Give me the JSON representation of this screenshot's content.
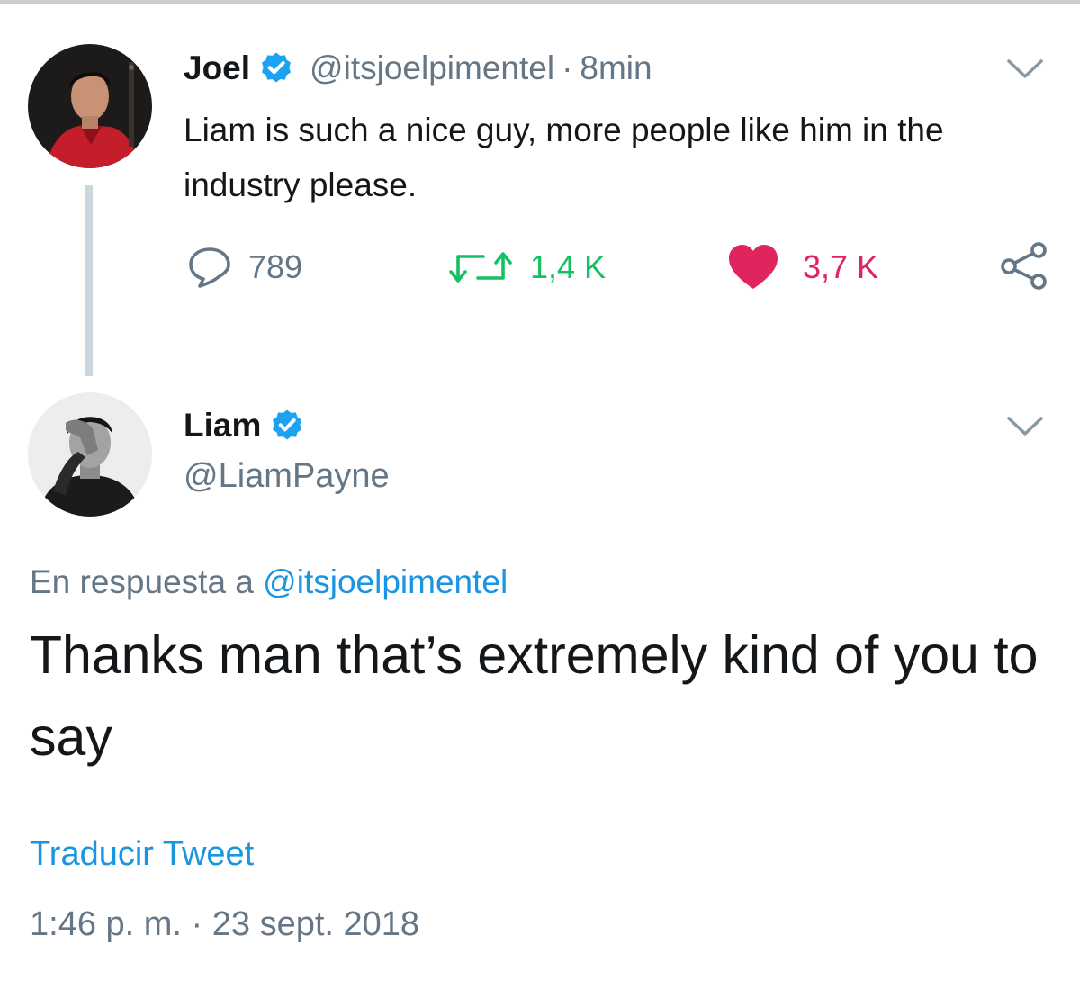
{
  "colors": {
    "text": "#14171a",
    "secondary": "#657786",
    "link": "#1b95e0",
    "retweet": "#17bf63",
    "like": "#e0245e",
    "verified": "#1da1f2",
    "thread_line": "#ccd6dd"
  },
  "original_tweet": {
    "display_name": "Joel",
    "verified_icon": "verified-badge-icon",
    "handle": "@itsjoelpimentel",
    "separator": "·",
    "time": "8min",
    "text": "Liam is such a nice guy, more people like him in the industry please.",
    "actions": {
      "reply": {
        "icon": "reply-bubble-icon",
        "count": "789"
      },
      "retweet": {
        "icon": "retweet-icon",
        "count": "1,4 K"
      },
      "like": {
        "icon": "heart-icon",
        "count": "3,7 K"
      },
      "share": {
        "icon": "share-icon"
      }
    },
    "menu_icon": "chevron-down-icon"
  },
  "reply_tweet": {
    "display_name": "Liam",
    "verified_icon": "verified-badge-icon",
    "handle": "@LiamPayne",
    "menu_icon": "chevron-down-icon",
    "reply_context_prefix": "En respuesta a",
    "reply_context_mention": "@itsjoelpimentel",
    "text": "Thanks man that’s extremely kind of you to say",
    "translate_link": "Traducir Tweet",
    "timestamp": "1:46 p. m. · 23 sept. 2018"
  }
}
